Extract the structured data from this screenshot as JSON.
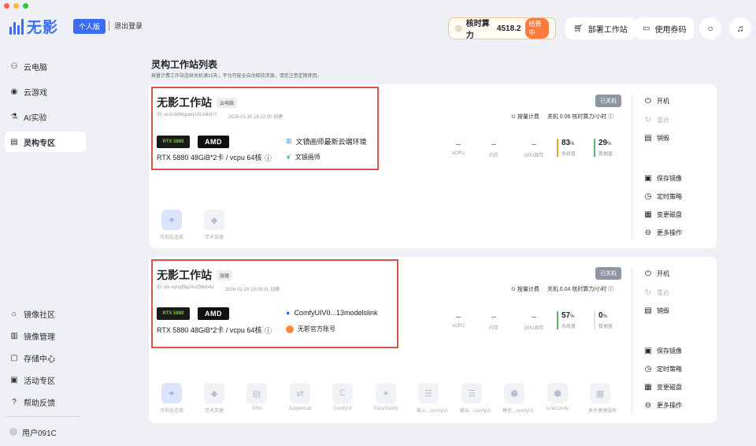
{
  "app": {
    "logo_text": "无影",
    "plan_badge": "个人版",
    "logout": "退出登录"
  },
  "header": {
    "credits_label": "核时算力",
    "credits_value": "4518.2",
    "credits_tag": "结费中",
    "deploy_label": "部署工作站",
    "voucher_label": "使用券码"
  },
  "sidebar": {
    "items": [
      {
        "label": "云电脑",
        "icon": "user-icon"
      },
      {
        "label": "云游戏",
        "icon": "gamepad-icon"
      },
      {
        "label": "AI实验",
        "icon": "flask-icon"
      },
      {
        "label": "灵构专区",
        "icon": "workstation-icon"
      }
    ],
    "bottom_items": [
      {
        "label": "镜像社区",
        "icon": "home-icon"
      },
      {
        "label": "镜像管理",
        "icon": "book-icon"
      },
      {
        "label": "存储中心",
        "icon": "folder-icon"
      },
      {
        "label": "活动专区",
        "icon": "gift-icon"
      },
      {
        "label": "帮助反馈",
        "icon": "help-icon"
      }
    ],
    "user_label": "用户091C"
  },
  "main": {
    "title": "灵构工作站列表",
    "desc": "按量计费工作站连续关机满15天，平台可能全自动释放资源，请您注意定期使用。"
  },
  "cards": [
    {
      "title": "无影工作站",
      "tag": "云电脑",
      "id_text": "ID: ecd-089kgueq101e9k87z",
      "date_text": "2026-01-30 16:12:00 创建",
      "gpu_text": "RTX 5880",
      "amd_text": "AMD",
      "spec": "RTX 5880 48GiB*2卡 / vcpu 64核",
      "env_main": "文镜画师最新云端环境",
      "env_sub": "文镜画师",
      "billing": "按量计费",
      "rate": "关机 0.06 核时算力/小时",
      "status": "已关机",
      "metrics": [
        {
          "value": "--",
          "label": "vCPU"
        },
        {
          "value": "--",
          "label": "内存"
        },
        {
          "value": "--",
          "label": "GPU显存"
        }
      ],
      "sys_disk": {
        "value": "83",
        "unit": "%",
        "label": "系统盘"
      },
      "data_disk": {
        "value": "29",
        "unit": "%",
        "label": "数据盘"
      },
      "tools": [
        {
          "label": "可视化连接",
          "icon": "link-icon"
        },
        {
          "label": "学术加速",
          "icon": "graduation-icon"
        }
      ]
    },
    {
      "title": "无影工作站",
      "tag": "容器",
      "id_text": "ID: ws-nyoqf9q24o25lkm42",
      "date_text": "2026-01-29 18:08:01 创建",
      "gpu_text": "RTX 5880",
      "amd_text": "AMD",
      "spec": "RTX 5880 48GiB*2卡 / vcpu 64核",
      "env_main": "ComfyUIV0...13modelslink",
      "env_sub": "无影官方账号",
      "billing": "按量计费",
      "rate": "关机 0.04 核时算力/小时",
      "status": "已关机",
      "metrics": [
        {
          "value": "--",
          "label": "vCPU"
        },
        {
          "value": "--",
          "label": "内存"
        },
        {
          "value": "--",
          "label": "GPU显存"
        }
      ],
      "sys_disk": {
        "value": "57",
        "unit": "%",
        "label": "系统盘"
      },
      "data_disk": {
        "value": "0",
        "unit": "%",
        "label": "数据盘"
      },
      "tools": [
        {
          "label": "可视化连接",
          "icon": "link-icon"
        },
        {
          "label": "学术加速",
          "icon": "graduation-icon"
        },
        {
          "label": "SSH",
          "icon": "terminal-icon"
        },
        {
          "label": "JupyterLab",
          "icon": "jupyter-icon"
        },
        {
          "label": "ComfyUI",
          "icon": "comfy-icon"
        },
        {
          "label": "EasyComfy",
          "icon": "sparkle-icon"
        },
        {
          "label": "输入...comfyUI",
          "icon": "input-icon"
        },
        {
          "label": "输出...comfyUI",
          "icon": "output-icon"
        },
        {
          "label": "模型...comfyUI",
          "icon": "cube-icon"
        },
        {
          "label": "LinkComfy",
          "icon": "cube-link-icon"
        },
        {
          "label": "更多便捷服务",
          "icon": "grid-icon"
        }
      ]
    }
  ],
  "actions": {
    "start": "开机",
    "restart": "重启",
    "destroy": "销毁",
    "save_image": "保存镜像",
    "schedule": "定时策略",
    "change_disk": "变更磁盘",
    "more": "更多操作"
  }
}
